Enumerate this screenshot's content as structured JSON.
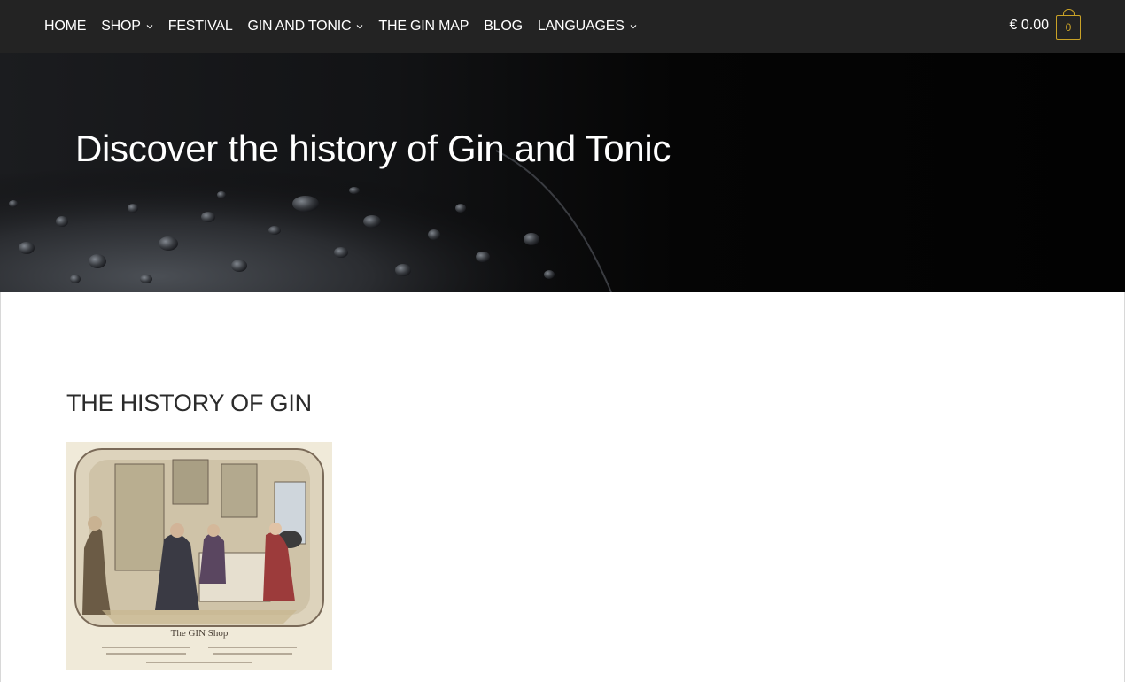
{
  "nav": {
    "items": [
      {
        "label": "HOME",
        "has_dropdown": false
      },
      {
        "label": "SHOP",
        "has_dropdown": true
      },
      {
        "label": "FESTIVAL",
        "has_dropdown": false
      },
      {
        "label": "GIN AND TONIC",
        "has_dropdown": true
      },
      {
        "label": "THE GIN MAP",
        "has_dropdown": false
      },
      {
        "label": "BLOG",
        "has_dropdown": false
      },
      {
        "label": "LANGUAGES",
        "has_dropdown": true
      }
    ]
  },
  "cart": {
    "amount": "€ 0.00",
    "count": "0",
    "icon": "shopping-bag-icon"
  },
  "hero": {
    "title": "Discover the history of Gin and Tonic"
  },
  "content": {
    "section_title": "THE HISTORY OF GIN",
    "image_caption": "The GIN Shop"
  },
  "colors": {
    "topbar": "#232323",
    "accent": "#c9a227",
    "text_light": "#ffffff"
  }
}
